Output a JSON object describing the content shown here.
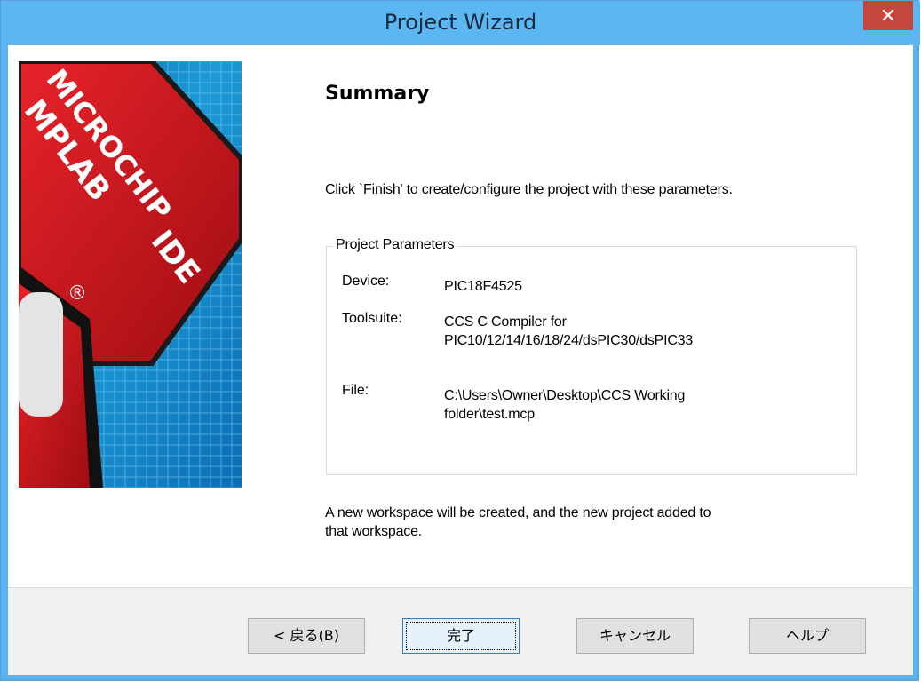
{
  "window": {
    "title": "Project Wizard",
    "close_glyph": "✕"
  },
  "banner": {
    "brand_line1": "MICROCHIP",
    "brand_line2": "MPLAB",
    "brand_line3": "IDE",
    "reg_mark": "®"
  },
  "summary": {
    "heading": "Summary",
    "intro": "Click `Finish' to create/configure the project with these parameters.",
    "group_title": "Project Parameters",
    "device_label": "Device:",
    "device_value": "PIC18F4525",
    "toolsuite_label": "Toolsuite:",
    "toolsuite_line1": "CCS C Compiler for",
    "toolsuite_line2": "PIC10/12/14/16/18/24/dsPIC30/dsPIC33",
    "file_label": "File:",
    "file_line1": "C:\\Users\\Owner\\Desktop\\CCS Working",
    "file_line2": "folder\\test.mcp",
    "footnote_line1": "A new workspace will be created, and the new project added to",
    "footnote_line2": "that workspace."
  },
  "buttons": {
    "back": "< 戻る(B)",
    "finish": "完了",
    "cancel": "キャンセル",
    "help": "ヘルプ"
  },
  "colors": {
    "titlebar": "#5cb6f2",
    "close": "#c7463c",
    "banner_red": "#c8141b",
    "banner_blue": "#1f9fd8"
  }
}
